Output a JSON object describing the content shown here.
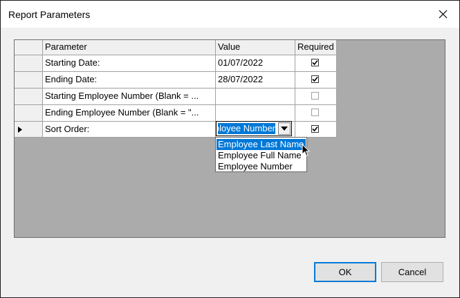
{
  "dialog": {
    "title": "Report Parameters"
  },
  "icons": {
    "close": "close-icon",
    "row_indicator": "triangle-right-icon",
    "dropdown_arrow": "chevron-down-icon",
    "checkmark": "checkmark-icon",
    "cursor": "mouse-pointer-icon"
  },
  "grid": {
    "columns": [
      "Parameter",
      "Value",
      "Required"
    ],
    "rows": [
      {
        "parameter": "Starting Date:",
        "value": "01/07/2022",
        "required": true,
        "enabled": true
      },
      {
        "parameter": "Ending Date:",
        "value": "28/07/2022",
        "required": true,
        "enabled": true
      },
      {
        "parameter": "Starting Employee Number (Blank = ...",
        "value": "",
        "required": false,
        "enabled": false
      },
      {
        "parameter": "Ending Employee Number (Blank = \"...",
        "value": "",
        "required": false,
        "enabled": false
      },
      {
        "parameter": "Sort Order:",
        "value": "Employee Number",
        "required": true,
        "enabled": true
      }
    ]
  },
  "sort_dropdown": {
    "current_value": "Employee Number",
    "options": [
      "Employee Last Name",
      "Employee Full Name",
      "Employee Number"
    ],
    "highlighted": "Employee Last Name"
  },
  "buttons": {
    "ok": "OK",
    "cancel": "Cancel"
  },
  "colors": {
    "selection": "#0078d7",
    "grid_background": "#ababab",
    "dialog_background": "#f0f0f0"
  }
}
